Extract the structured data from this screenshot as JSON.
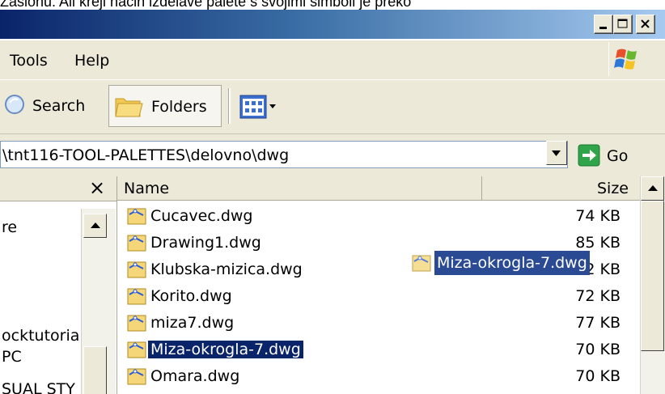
{
  "top_text": "Zaslonu. Ali kreji način izdelave palete s svojimi simboli je preko",
  "menu": {
    "tools": "Tools",
    "help": "Help"
  },
  "toolbar": {
    "search": "Search",
    "folders": "Folders"
  },
  "address": {
    "path": "\\tnt116-TOOL-PALETTES\\delovno\\dwg",
    "go": "Go"
  },
  "left_pane": {
    "close": "×",
    "items": [
      "re",
      "ocktutoria",
      "PC",
      "SUAL STY"
    ]
  },
  "columns": {
    "name": "Name",
    "size": "Size"
  },
  "files": [
    {
      "name": "Cucavec.dwg",
      "size": "74 KB"
    },
    {
      "name": "Drawing1.dwg",
      "size": "85 KB"
    },
    {
      "name": "Klubska-mizica.dwg",
      "size": "72 KB"
    },
    {
      "name": "Korito.dwg",
      "size": "72 KB"
    },
    {
      "name": "miza7.dwg",
      "size": "77 KB"
    },
    {
      "name": "Miza-okrogla-7.dwg",
      "size": "70 KB"
    },
    {
      "name": "Omara.dwg",
      "size": "70 KB"
    }
  ],
  "drag_ghost": "Miza-okrogla-7.dwg",
  "icons": [
    "minimize-icon",
    "maximize-icon",
    "close-icon",
    "windows-logo-icon",
    "search-icon",
    "folders-icon",
    "views-icon",
    "dropdown-arrow-icon",
    "go-arrow-icon",
    "dwg-file-icon",
    "scroll-up-icon"
  ]
}
